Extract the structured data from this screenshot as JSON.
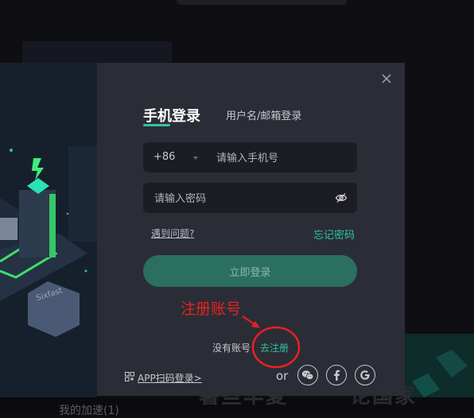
{
  "modal": {
    "tab_phone": "手机登录",
    "tab_account": "用户名/邮箱登录",
    "country_code": "+86",
    "phone_placeholder": "请输入手机号",
    "password_placeholder": "请输入密码",
    "problem_link": "遇到问题?",
    "forgot_link": "忘记密码",
    "login_button": "立即登录",
    "no_account_text": "没有账号",
    "register_link": "去注册",
    "qr_login_link": "APP扫码登录>",
    "or_text": "or"
  },
  "annotation": {
    "text": "注册账号",
    "color": "#e8221f"
  },
  "background": {
    "bottom_text": "我的加速(1)",
    "bottom_big_text_1": "暑些华夏",
    "bottom_big_text_2": "论国家",
    "box_label": "Sixfast"
  },
  "icons": {
    "close": "close-icon",
    "eye": "eye-off-icon",
    "qr": "qr-code-icon",
    "wechat": "wechat-icon",
    "facebook": "facebook-icon",
    "google": "google-icon"
  },
  "colors": {
    "accent": "#2ec4a0",
    "modal_bg": "#2b2d36",
    "field_bg": "#1c1d23",
    "login_button_bg": "#2a6f5f"
  }
}
